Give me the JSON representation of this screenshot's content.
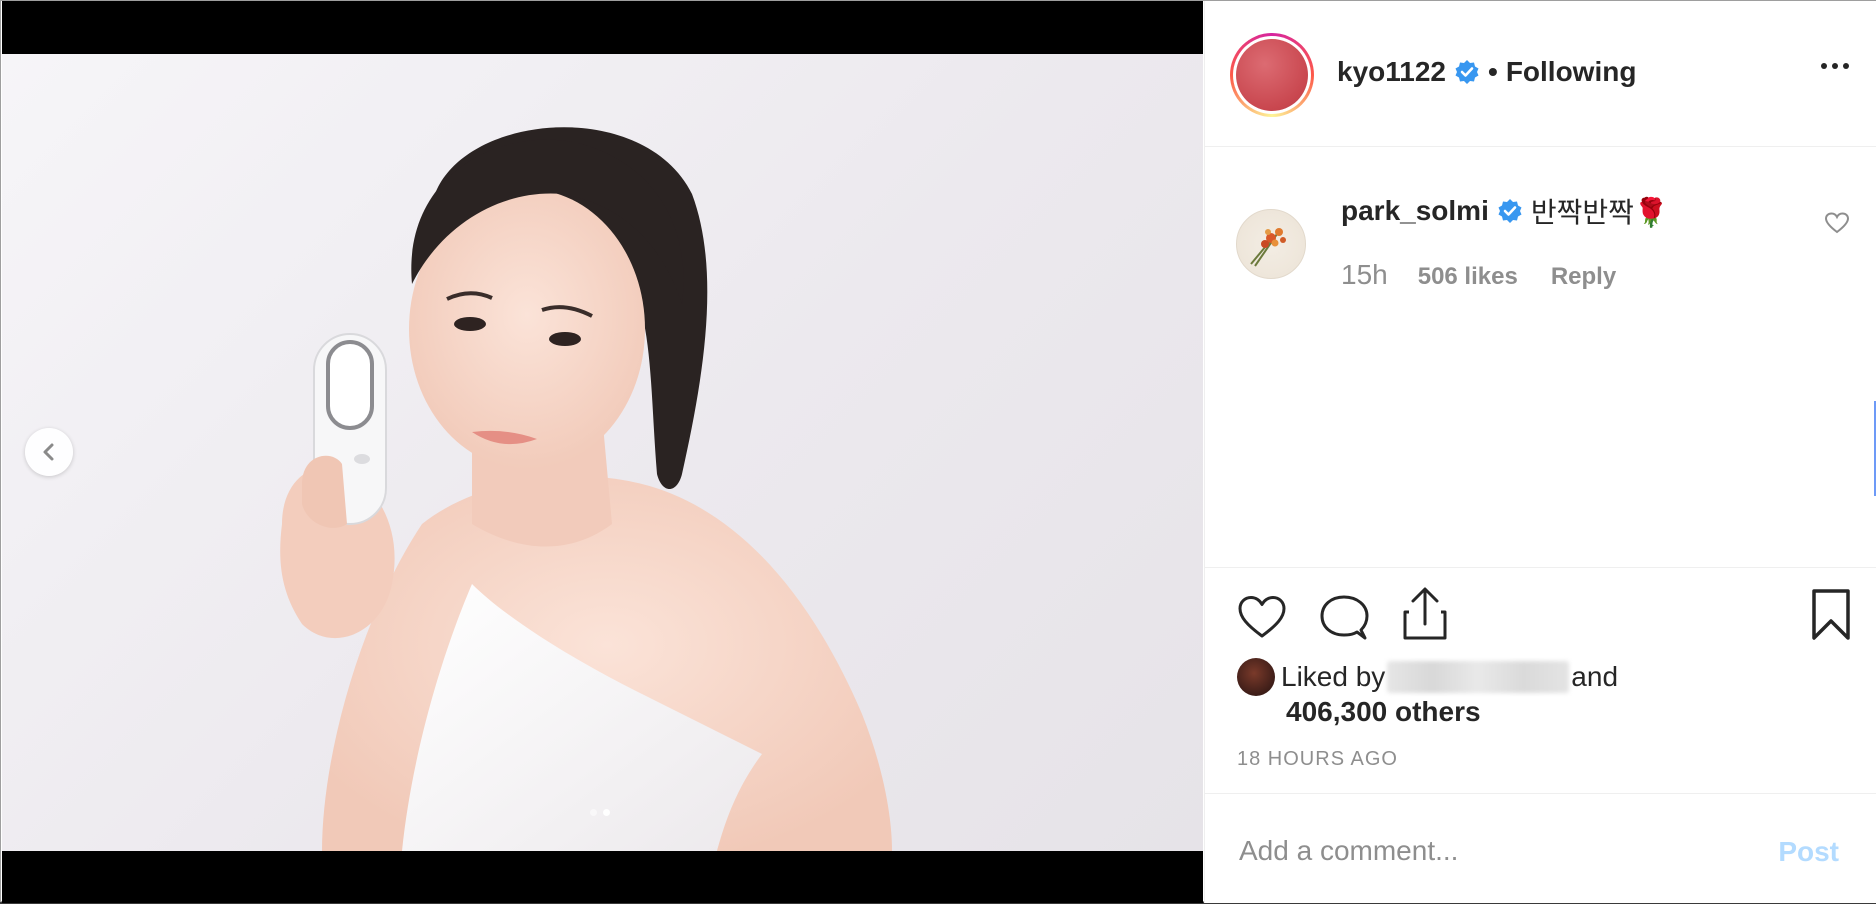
{
  "post": {
    "author": "kyo1122",
    "separator": "•",
    "follow_status": "Following",
    "slide_count": 2,
    "active_slide": 2
  },
  "comment": {
    "username": "park_solmi",
    "text": "반짝반짝🌹",
    "time": "15h",
    "likes": "506 likes",
    "reply": "Reply"
  },
  "likes": {
    "prefix": "Liked by",
    "conjunction": "and",
    "others": "406,300 others"
  },
  "timestamp": "18 HOURS AGO",
  "add_comment": {
    "placeholder": "Add a comment...",
    "post_label": "Post"
  },
  "colors": {
    "verified": "#3897f0",
    "post_disabled": "#b3dbff",
    "meta_gray": "#8e8e8e"
  },
  "icons": {
    "prev": "chevron-left-icon",
    "like": "heart-icon",
    "comment": "comment-icon",
    "share": "share-icon",
    "save": "bookmark-icon",
    "more": "more-horizontal-icon"
  }
}
